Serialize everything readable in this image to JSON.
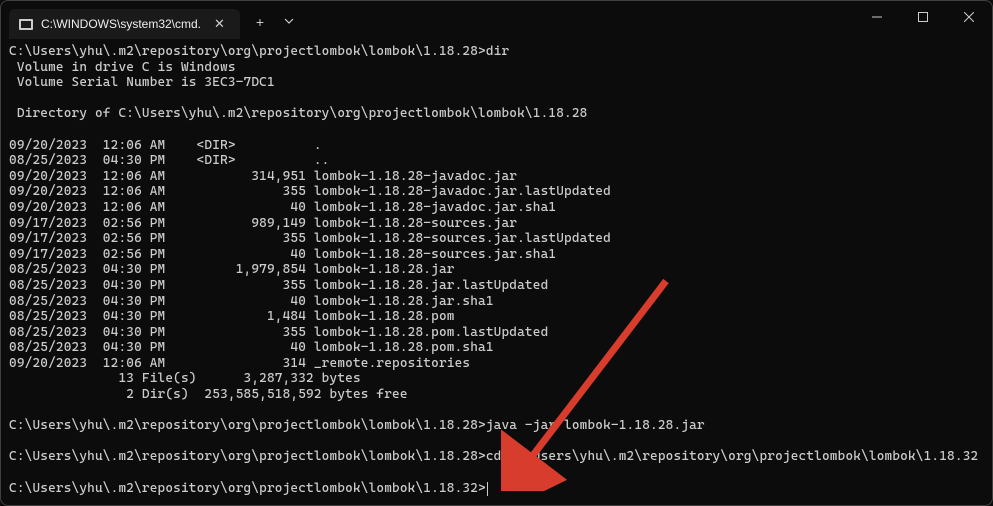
{
  "tab": {
    "title": "C:\\WINDOWS\\system32\\cmd. "
  },
  "terminal": {
    "line1": "C:\\Users\\yhu\\.m2\\repository\\org\\projectlombok\\lombok\\1.18.28>dir",
    "line2": " Volume in drive C is Windows",
    "line3": " Volume Serial Number is 3EC3-7DC1",
    "line4": "",
    "line5": " Directory of C:\\Users\\yhu\\.m2\\repository\\org\\projectlombok\\lombok\\1.18.28",
    "line6": "",
    "line7": "09/20/2023  12:06 AM    <DIR>          .",
    "line8": "08/25/2023  04:30 PM    <DIR>          ..",
    "line9": "09/20/2023  12:06 AM           314,951 lombok-1.18.28-javadoc.jar",
    "line10": "09/20/2023  12:06 AM               355 lombok-1.18.28-javadoc.jar.lastUpdated",
    "line11": "09/20/2023  12:06 AM                40 lombok-1.18.28-javadoc.jar.sha1",
    "line12": "09/17/2023  02:56 PM           989,149 lombok-1.18.28-sources.jar",
    "line13": "09/17/2023  02:56 PM               355 lombok-1.18.28-sources.jar.lastUpdated",
    "line14": "09/17/2023  02:56 PM                40 lombok-1.18.28-sources.jar.sha1",
    "line15": "08/25/2023  04:30 PM         1,979,854 lombok-1.18.28.jar",
    "line16": "08/25/2023  04:30 PM               355 lombok-1.18.28.jar.lastUpdated",
    "line17": "08/25/2023  04:30 PM                40 lombok-1.18.28.jar.sha1",
    "line18": "08/25/2023  04:30 PM             1,484 lombok-1.18.28.pom",
    "line19": "08/25/2023  04:30 PM               355 lombok-1.18.28.pom.lastUpdated",
    "line20": "08/25/2023  04:30 PM                40 lombok-1.18.28.pom.sha1",
    "line21": "09/20/2023  12:06 AM               314 _remote.repositories",
    "line22": "              13 File(s)      3,287,332 bytes",
    "line23": "               2 Dir(s)  253,585,518,592 bytes free",
    "line24": "",
    "line25": "C:\\Users\\yhu\\.m2\\repository\\org\\projectlombok\\lombok\\1.18.28>java -jar lombok-1.18.28.jar",
    "line26": "",
    "line27": "C:\\Users\\yhu\\.m2\\repository\\org\\projectlombok\\lombok\\1.18.28>cd C:\\Users\\yhu\\.m2\\repository\\org\\projectlombok\\lombok\\1.18.32",
    "line28": "",
    "line29": "C:\\Users\\yhu\\.m2\\repository\\org\\projectlombok\\lombok\\1.18.32>"
  }
}
